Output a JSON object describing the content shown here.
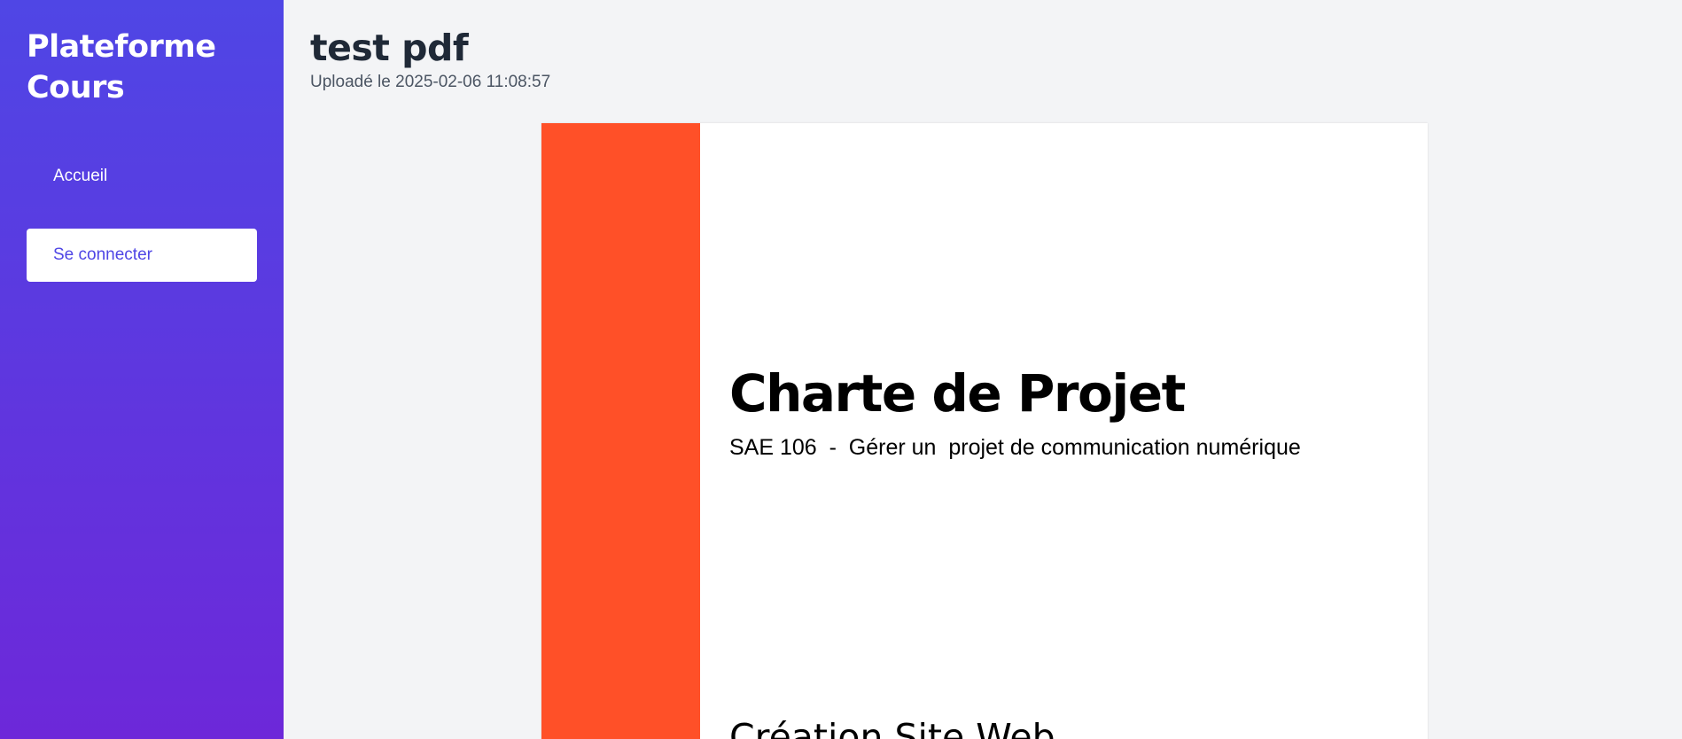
{
  "sidebar": {
    "brand_line1": "Plateforme",
    "brand_line2": "Cours",
    "nav": {
      "home_label": "Accueil",
      "login_label": "Se connecter"
    }
  },
  "document": {
    "title": "test pdf",
    "upload_info": "Uploadé le 2025-02-06 11:08:57"
  },
  "pdf": {
    "heading": "Charte de Projet",
    "subtitle": "SAE 106  -  Gérer un  projet de communication numérique",
    "section_title": "Création Site Web"
  },
  "colors": {
    "sidebar_gradient_start": "#4f46e5",
    "sidebar_gradient_end": "#6d28d9",
    "pdf_accent_band": "#ff5028",
    "login_button_text": "#4f46e5",
    "title_text": "#1f2937"
  }
}
